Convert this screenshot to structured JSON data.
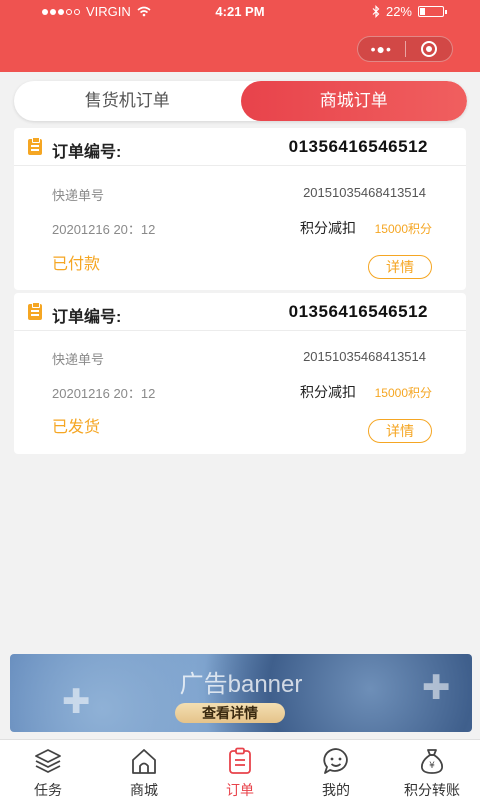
{
  "status_bar": {
    "carrier": "VIRGIN",
    "time": "4:21 PM",
    "battery": "22%",
    "battery_level": 0.22
  },
  "tabs": [
    {
      "label": "售货机订单",
      "active": false
    },
    {
      "label": "商城订单",
      "active": true
    }
  ],
  "orders": [
    {
      "order_label": "订单编号:",
      "order_no": "01356416546512",
      "tracking_label": "快递单号",
      "tracking_no": "20151035468413514",
      "date": "20201216 20：12",
      "points_label": "积分减扣",
      "points_value": "15000积分",
      "status": "已付款",
      "detail_label": "详情"
    },
    {
      "order_label": "订单编号:",
      "order_no": "01356416546512",
      "tracking_label": "快递单号",
      "tracking_no": "20151035468413514",
      "date": "20201216 20：12",
      "points_label": "积分减扣",
      "points_value": "15000积分",
      "status": "已发货",
      "detail_label": "详情"
    }
  ],
  "banner": {
    "title": "广告banner",
    "button_label": "查看详情"
  },
  "tabbar": [
    {
      "label": "任务",
      "icon": "layers-icon",
      "active": false
    },
    {
      "label": "商城",
      "icon": "home-icon",
      "active": false
    },
    {
      "label": "订单",
      "icon": "clipboard-icon",
      "active": true
    },
    {
      "label": "我的",
      "icon": "face-icon",
      "active": false
    },
    {
      "label": "积分转账",
      "icon": "money-bag-icon",
      "active": false
    }
  ],
  "colors": {
    "accent": "#ef5350",
    "orange": "#f5a623",
    "active_tab": "#e8434b"
  }
}
